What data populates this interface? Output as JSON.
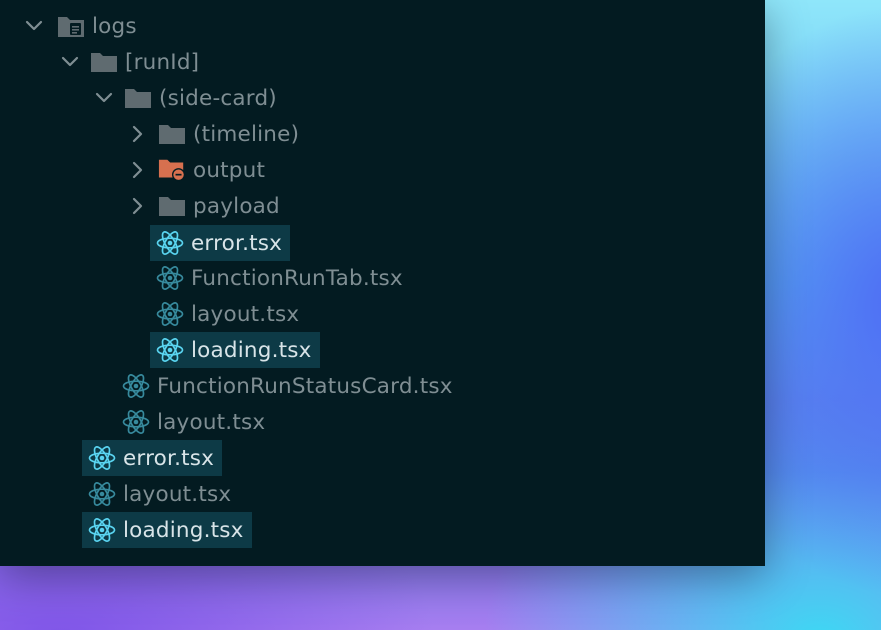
{
  "tree": {
    "folders": {
      "logs": "logs",
      "runid": "[runId]",
      "side_card": "(side-card)",
      "timeline": "(timeline)",
      "output": "output",
      "payload": "payload"
    },
    "files": {
      "error_inner": "error.tsx",
      "function_run_tab": "FunctionRunTab.tsx",
      "layout_inner": "layout.tsx",
      "loading_inner": "loading.tsx",
      "function_run_status_card": "FunctionRunStatusCard.tsx",
      "layout_mid": "layout.tsx",
      "error_outer": "error.tsx",
      "layout_outer": "layout.tsx",
      "loading_outer": "loading.tsx"
    }
  },
  "colors": {
    "panel": "#031b21",
    "highlight": "#0d3a46",
    "folder": "#5f6b70",
    "folder_excluded": "#d6704f",
    "react_icon": "#5ad4f0"
  }
}
